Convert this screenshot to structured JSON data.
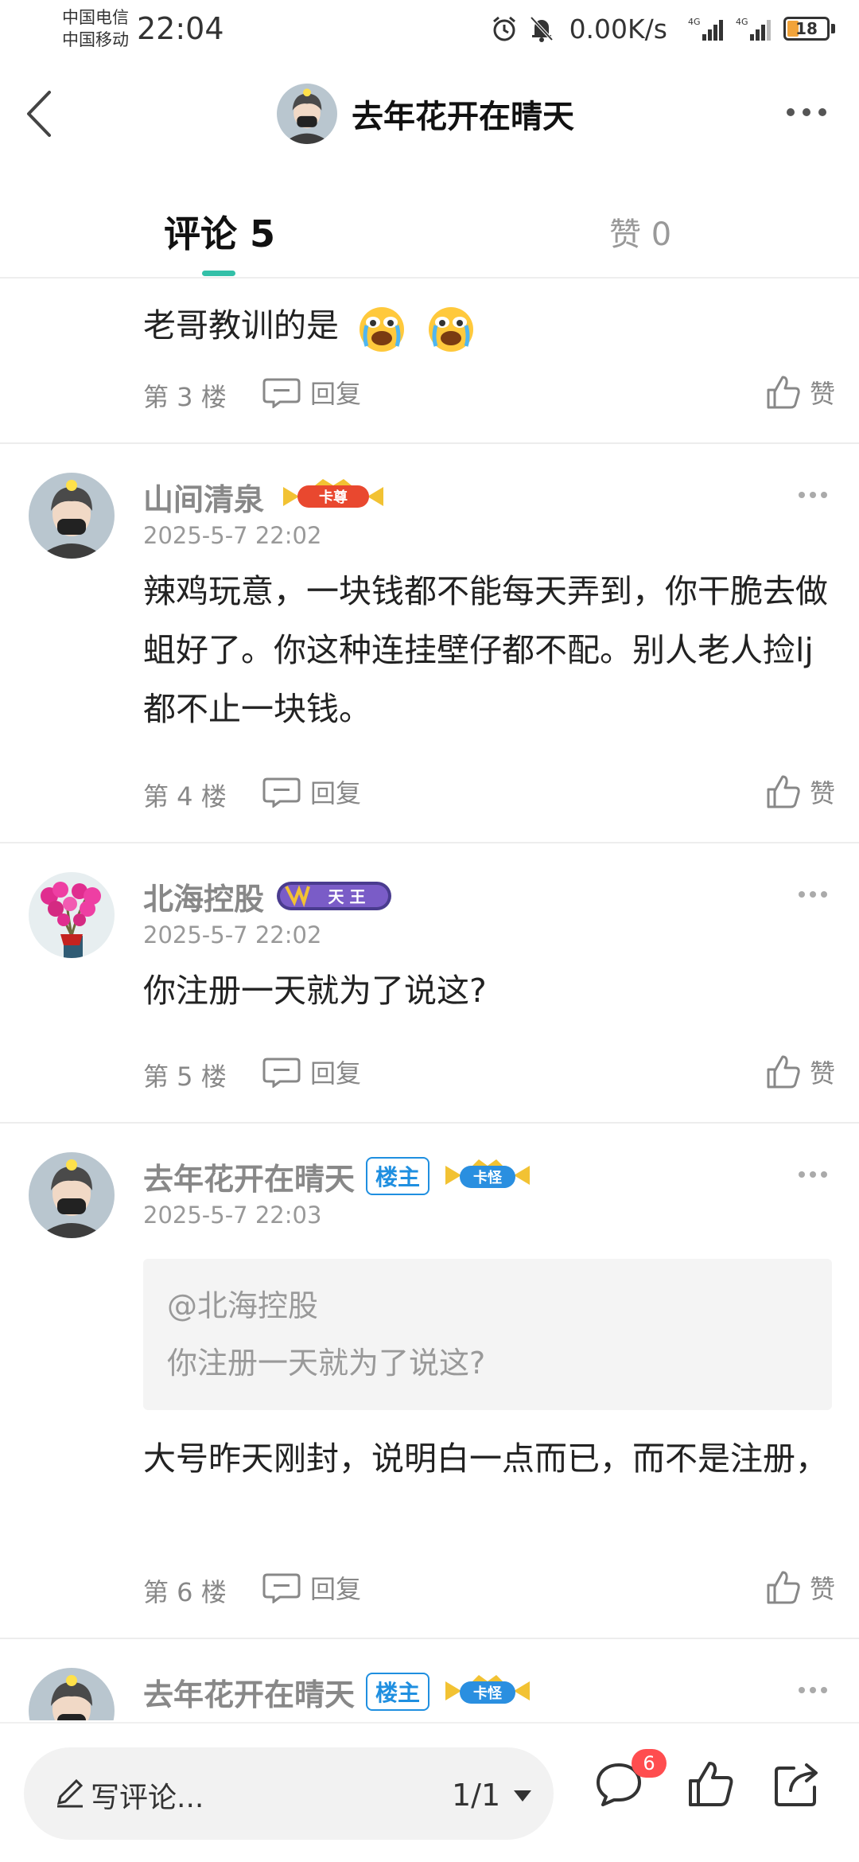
{
  "status_bar": {
    "carrier1": "中国电信",
    "carrier2": "中国移动",
    "time": "22:04",
    "network_speed": "0.00K/s",
    "battery": "18",
    "signal_label": "4G"
  },
  "header": {
    "title": "去年花开在晴天"
  },
  "tabs": {
    "comments": "评论 5",
    "likes": "赞 0"
  },
  "comments": [
    {
      "text": "老哥教训的是",
      "floor": "第 3 楼",
      "reply": "回复",
      "like": "赞"
    },
    {
      "user": "山间清泉",
      "badge_text": "卡尊",
      "time": "2025-5-7 22:02",
      "text": "辣鸡玩意，一块钱都不能每天弄到，你干脆去做蛆好了。你这种连挂壁仔都不配。别人老人捡lj都不止一块钱。",
      "floor": "第 4 楼",
      "reply": "回复",
      "like": "赞"
    },
    {
      "user": "北海控股",
      "badge_text": "天 王",
      "time": "2025-5-7 22:02",
      "text": "你注册一天就为了说这?",
      "floor": "第 5 楼",
      "reply": "回复",
      "like": "赞"
    },
    {
      "user": "去年花开在晴天",
      "author_tag": "楼主",
      "badge_text": "卡怪",
      "time": "2025-5-7 22:03",
      "quote_user": "@北海控股",
      "quote_text": "你注册一天就为了说这?",
      "text": "大号昨天刚封，说明白一点而已，而不是注册，",
      "floor": "第 6 楼",
      "reply": "回复",
      "like": "赞"
    },
    {
      "user": "去年花开在晴天",
      "author_tag": "楼主",
      "badge_text": "卡怪"
    }
  ],
  "bottom_bar": {
    "input_placeholder": "写评论...",
    "page_indicator": "1/1",
    "comment_badge": "6"
  },
  "colors": {
    "accent": "#33c0a8",
    "author_tag": "#1f8fe0",
    "badge": "#ff4d4f"
  },
  "icons": [
    "back-icon",
    "more-icon",
    "reply-icon",
    "like-icon",
    "pencil-icon",
    "comment-icon",
    "share-icon",
    "alarm-icon",
    "mute-icon",
    "signal-icon",
    "battery-icon"
  ]
}
